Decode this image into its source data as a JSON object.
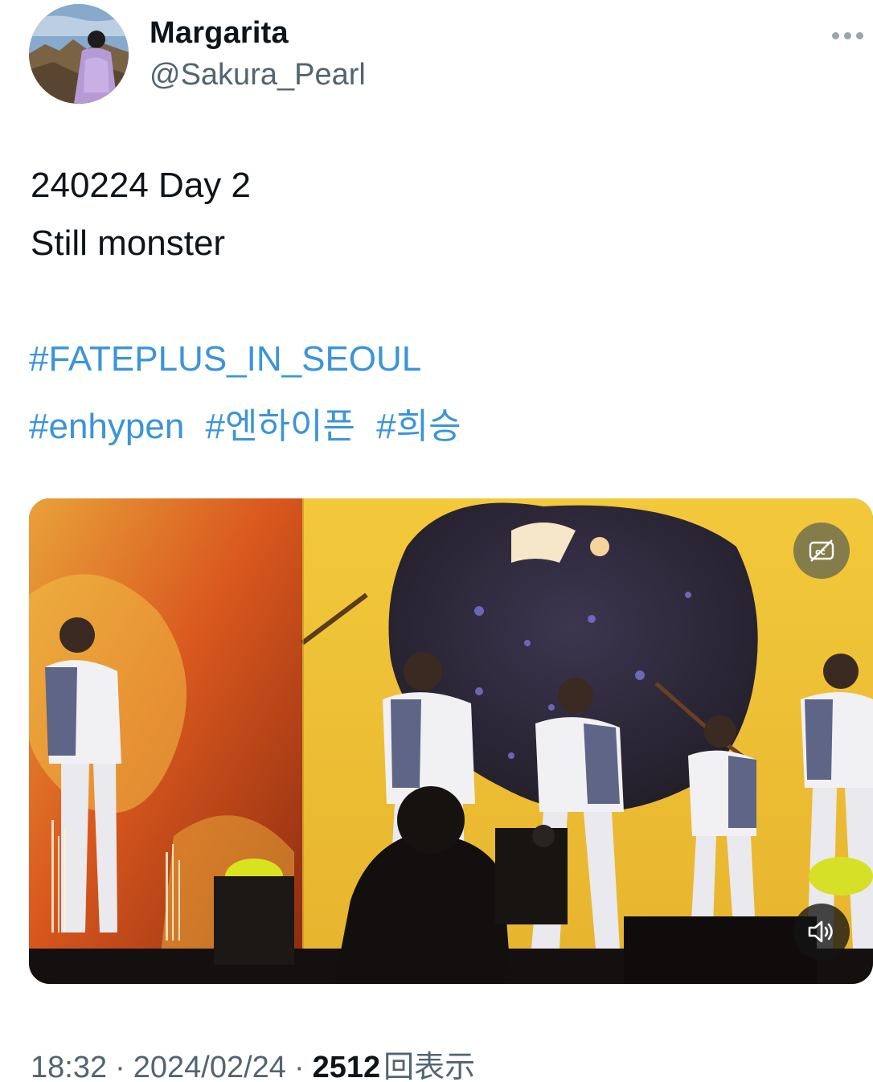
{
  "author": {
    "display_name": "Margarita",
    "handle": "@Sakura_Pearl",
    "avatar_icon": "profile-photo"
  },
  "tweet": {
    "lines": [
      "240224 Day 2",
      "Still monster"
    ],
    "hashtags_line1": [
      "#FATEPLUS_IN_SEOUL"
    ],
    "hashtags_line2": [
      "#enhypen",
      "#엔하이픈",
      "#희승"
    ]
  },
  "media": {
    "type": "video",
    "captions_icon": "captions-off-icon",
    "volume_icon": "speaker-icon"
  },
  "meta": {
    "time": "18:32",
    "date": "2024/02/24",
    "separator": "·",
    "views": "2512",
    "views_label": "回表示"
  },
  "colors": {
    "link": "#3b94d9",
    "secondary_text": "#536471",
    "primary_text": "#0f1419"
  }
}
